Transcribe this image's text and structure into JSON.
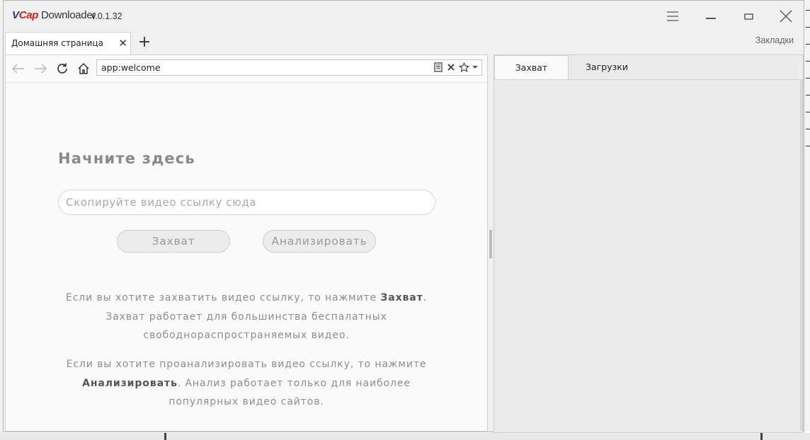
{
  "app": {
    "logo_v": "V",
    "logo_cap": "Cap",
    "logo_name": " Downloader",
    "version": "v.0.1.32"
  },
  "tabs": {
    "home_label": "Домашняя страница",
    "close_glyph": "✕",
    "add_glyph": "+"
  },
  "bookmarks_label": "Закладки",
  "navbar": {
    "url": "app:welcome"
  },
  "welcome": {
    "title": "Начните здесь",
    "input_placeholder": "Скопируйте видео ссылку сюда",
    "capture_button": "Захват",
    "analyze_button": "Анализировать",
    "info1_pre": "Если вы хотите захватить видео ссылку, то нажмите ",
    "info1_bold": "Захват",
    "info1_post": ". Захват работает для большинства беспалатных свободнораспространяемых видео.",
    "info2_pre": "Если вы хотите проанализировать видео ссылку, то нажмите ",
    "info2_bold": "Анализировать",
    "info2_post": ". Анализ работает только для наиболее популярных видео сайтов."
  },
  "side_panel": {
    "tab_capture": "Захват",
    "tab_downloads": "Загрузки"
  },
  "colors": {
    "logo_blue": "#1a3d8f",
    "logo_red": "#d81e1e"
  }
}
